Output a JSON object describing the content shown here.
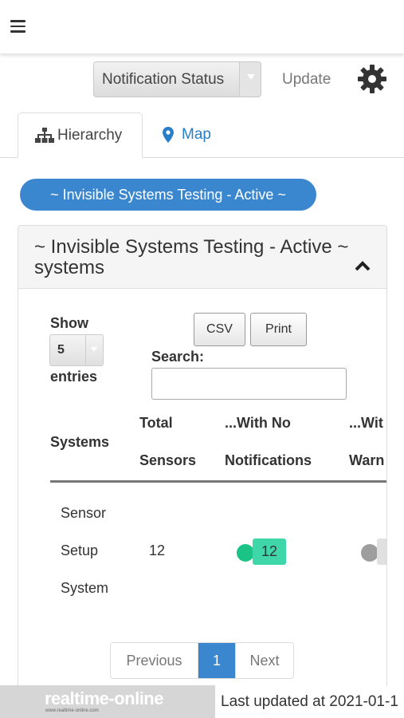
{
  "header": {
    "menu_icon": "hamburger-icon"
  },
  "controls": {
    "notification_select": "Notification Status",
    "update_label": "Update",
    "settings_icon": "gear-icon"
  },
  "tabs": [
    {
      "label": "Hierarchy",
      "icon": "sitemap-icon",
      "active": true
    },
    {
      "label": "Map",
      "icon": "map-marker-icon",
      "active": false
    }
  ],
  "group_pill": "~ Invisible Systems Testing - Active ~",
  "panel": {
    "title": "~ Invisible Systems Testing - Active ~ systems",
    "collapse_icon": "chevron-up-icon"
  },
  "table_controls": {
    "show_label": "Show",
    "page_length": "5",
    "entries_label": "entries",
    "csv_label": "CSV",
    "print_label": "Print",
    "search_label": "Search:",
    "search_value": ""
  },
  "table": {
    "headers": [
      "Systems",
      "Total",
      "Sensors",
      "...With No",
      "Notifications",
      "...Wit",
      "Warn"
    ],
    "rows": [
      {
        "system_lines": [
          "Sensor",
          "Setup",
          "System"
        ],
        "total_sensors": "12",
        "no_notifications": "12",
        "warnings": ""
      }
    ],
    "colors": {
      "ok": "#3fd6a9",
      "ok_dot": "#19c486",
      "grey_dot": "#9e9e9e"
    }
  },
  "pagination": {
    "previous": "Previous",
    "current": "1",
    "next": "Next"
  },
  "footer": {
    "logo_text": "realtime-online",
    "logo_sub": "www.realtime-online.com",
    "last_updated": "Last updated at 2021-01-1"
  }
}
